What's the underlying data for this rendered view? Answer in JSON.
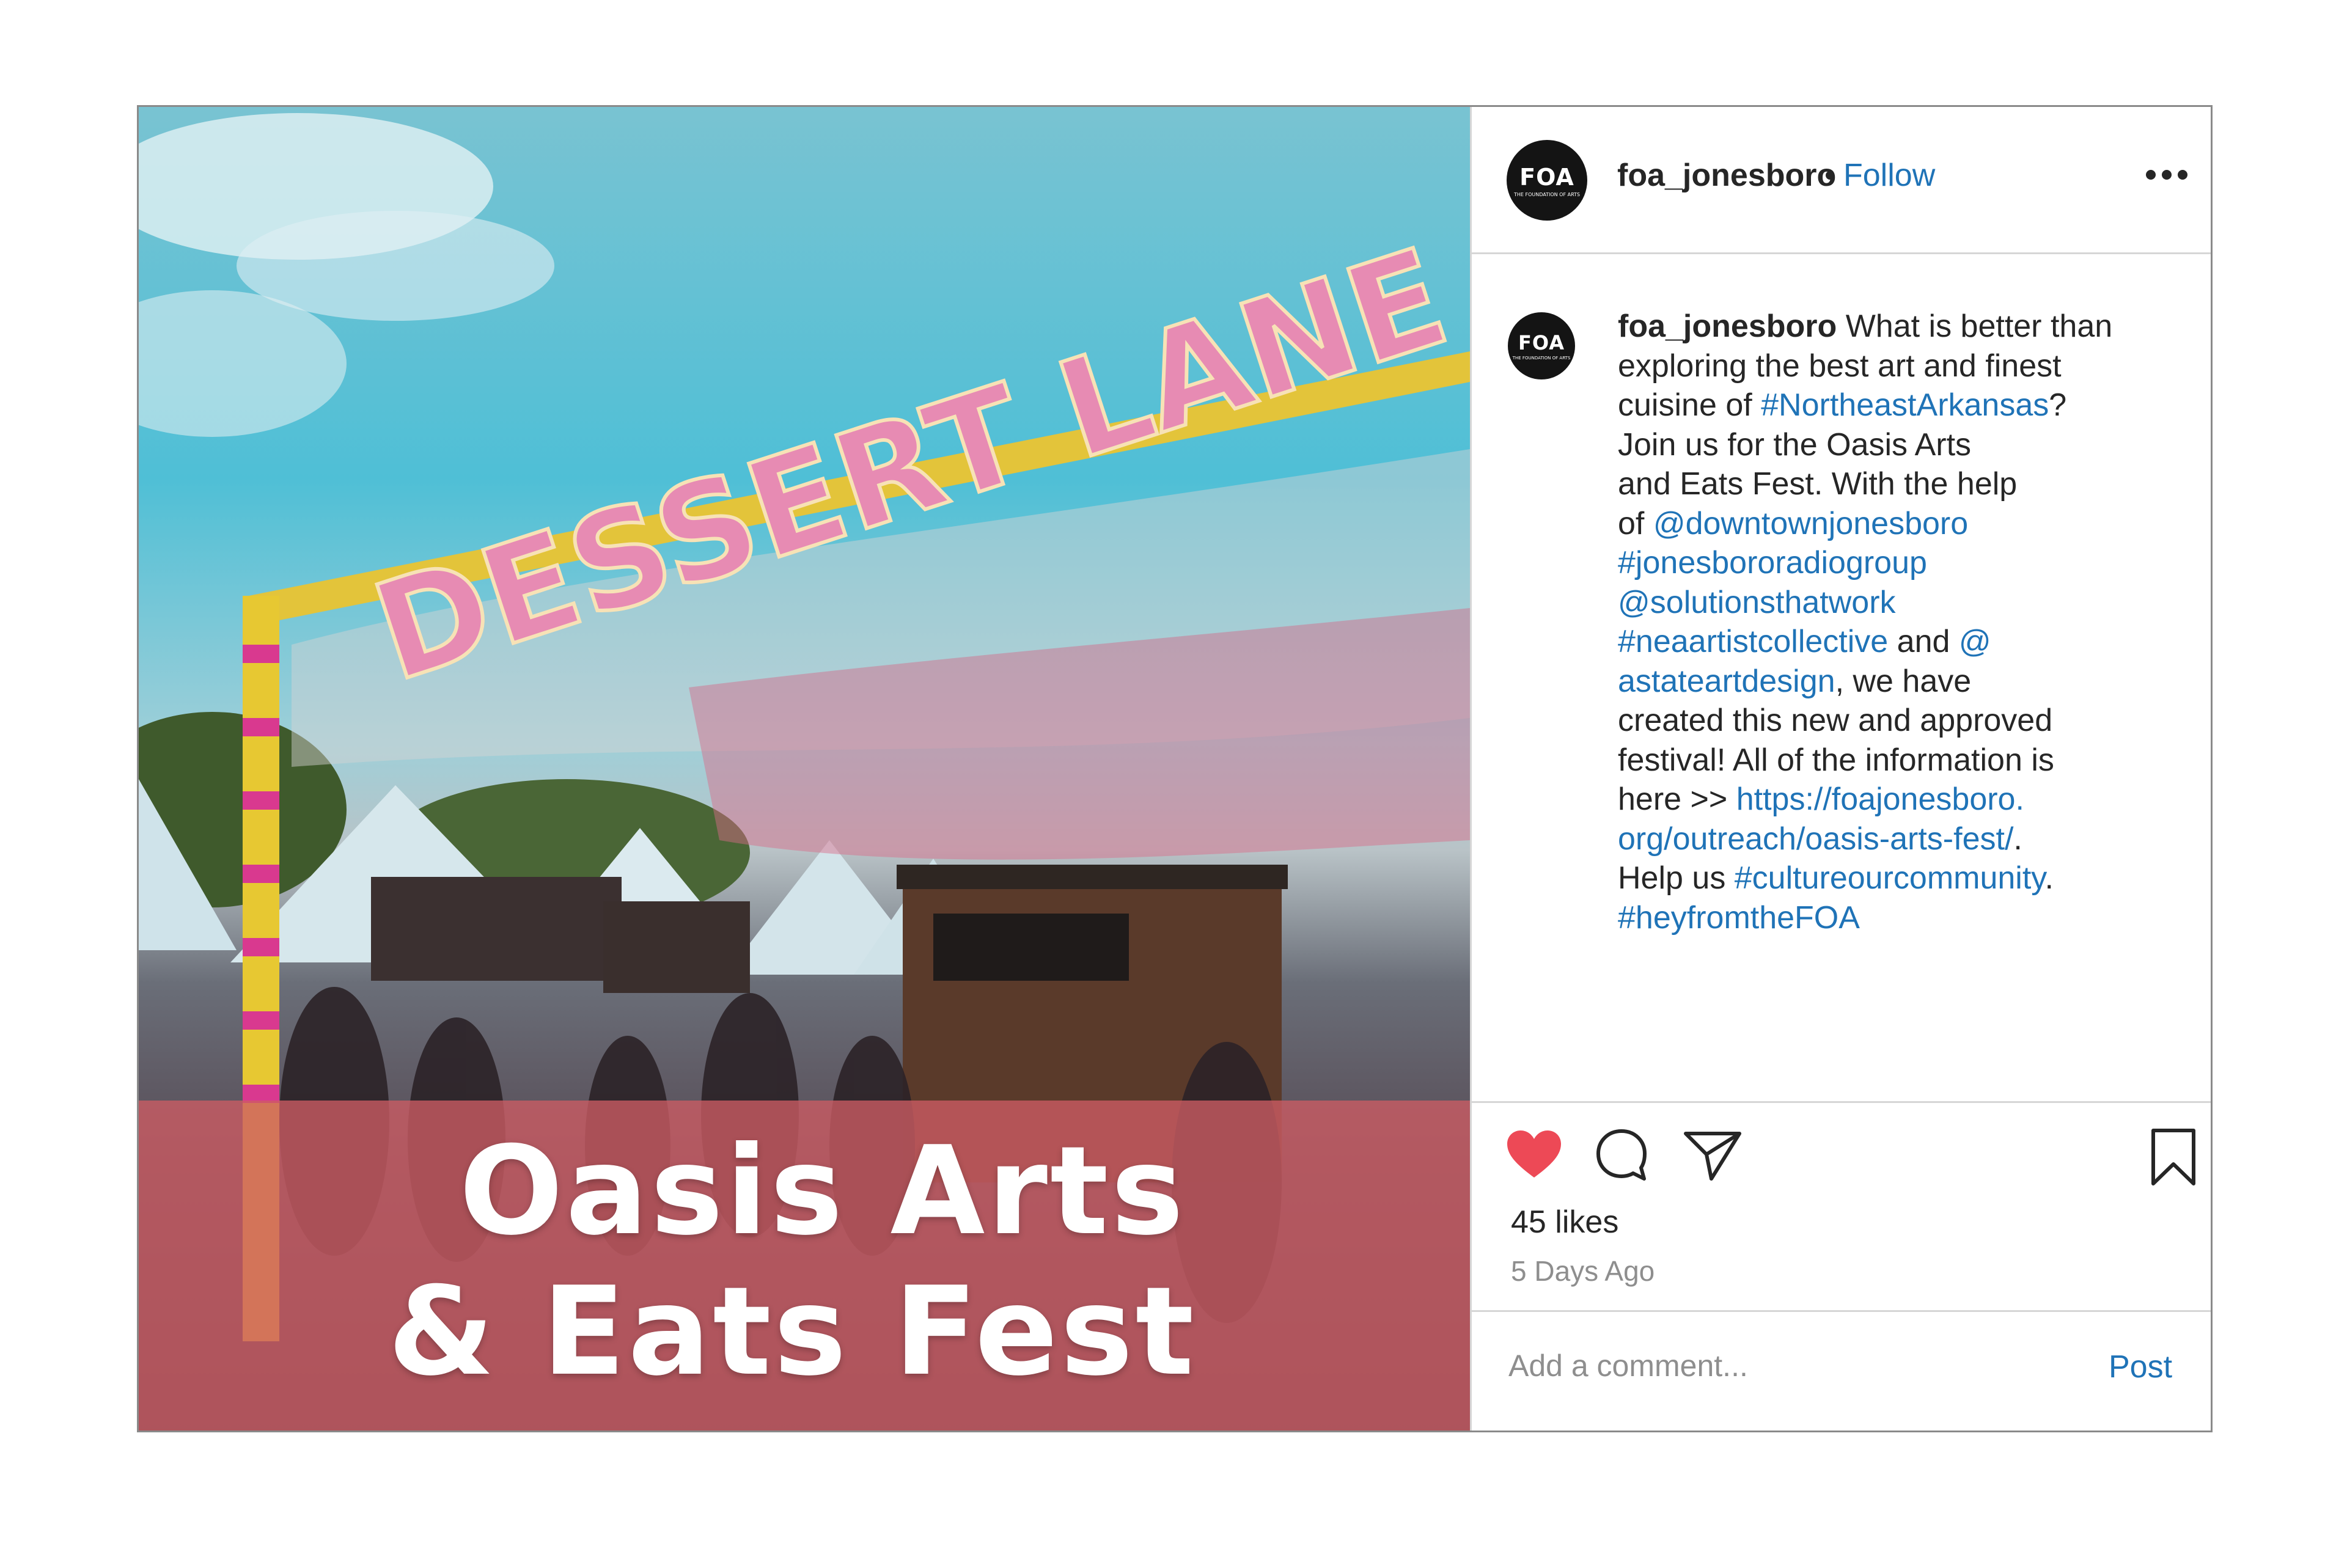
{
  "post": {
    "account": {
      "username": "foa_jonesboro",
      "follow_label": "Follow",
      "separator": "•"
    },
    "avatar": {
      "mark": "FOA",
      "sub": "THE FOUNDATION OF ARTS"
    },
    "image": {
      "sign_text": "DESSERT LANE",
      "overlay_line1": "Oasis Arts",
      "overlay_line2": "& Eats Fest"
    },
    "caption": {
      "username": "foa_jonesboro",
      "segments": [
        {
          "text": " What is better than\nexploring the best art and finest\ncuisine of ",
          "link": false
        },
        {
          "text": "#NortheastArkansas",
          "link": true
        },
        {
          "text": "?\nJoin us for the Oasis Arts\nand Eats Fest. With the help\nof ",
          "link": false
        },
        {
          "text": "@downtownjonesboro",
          "link": true
        },
        {
          "text": "\n",
          "link": false
        },
        {
          "text": "#jonesbororadiogroup",
          "link": true
        },
        {
          "text": "\n",
          "link": false
        },
        {
          "text": "@solutionsthatwork",
          "link": true
        },
        {
          "text": "\n",
          "link": false
        },
        {
          "text": "#neaartistcollective",
          "link": true
        },
        {
          "text": " and ",
          "link": false
        },
        {
          "text": "@\nastateartdesign",
          "link": true
        },
        {
          "text": ", we have\ncreated this new and approved\nfestival! All of the information is\nhere >> ",
          "link": false
        },
        {
          "text": "https://foajonesboro.\norg/outreach/oasis-arts-fest/",
          "link": true
        },
        {
          "text": ".\nHelp us ",
          "link": false
        },
        {
          "text": "#cultureourcommunity",
          "link": true
        },
        {
          "text": ".\n",
          "link": false
        },
        {
          "text": "#heyfromtheFOA",
          "link": true
        }
      ]
    },
    "actions": {
      "like": "heart-icon",
      "comment": "comment-icon",
      "share": "paper-plane-icon",
      "save": "bookmark-icon",
      "liked": true,
      "like_color": "#ed4956"
    },
    "likes_label": "45 likes",
    "timestamp": "5 Days Ago",
    "comment_box": {
      "placeholder": "Add a comment...",
      "post_label": "Post"
    },
    "colors": {
      "link": "#1f73b7",
      "text": "#262626",
      "muted": "#8e8e8e",
      "overlay": "#cd5c64"
    }
  }
}
